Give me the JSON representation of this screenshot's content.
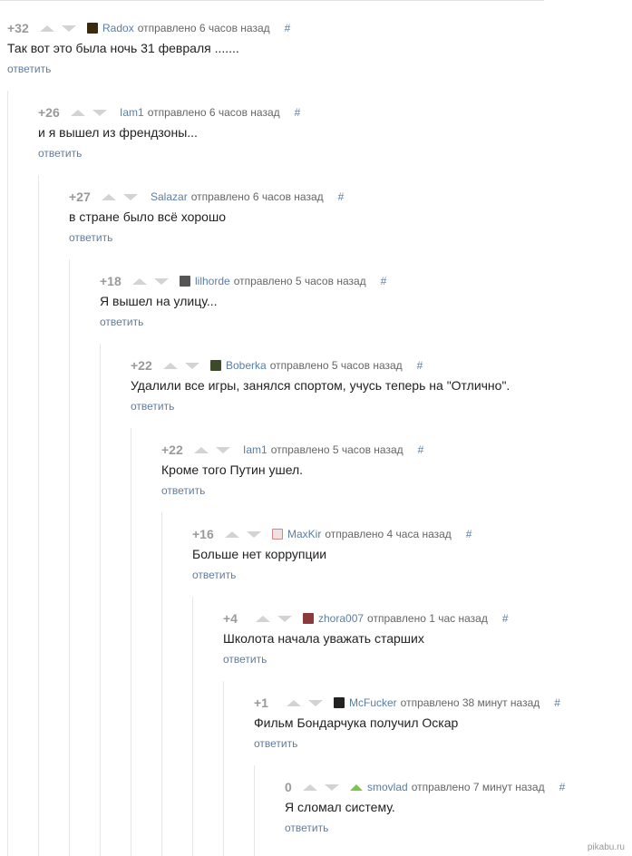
{
  "comments": [
    {
      "score": "+32",
      "author": "Radox",
      "sent": "отправлено 6 часов назад",
      "hash": "#",
      "text": "Так вот это была ночь 31 февраля .......",
      "reply": "ответить"
    },
    {
      "score": "+26",
      "author": "Iam1",
      "sent": "отправлено 6 часов назад",
      "hash": "#",
      "text": "и я вышел из френдзоны...",
      "reply": "ответить"
    },
    {
      "score": "+27",
      "author": "Salazar",
      "sent": "отправлено 6 часов назад",
      "hash": "#",
      "text": "в стране было всё хорошо",
      "reply": "ответить"
    },
    {
      "score": "+18",
      "author": "lilhorde",
      "sent": "отправлено 5 часов назад",
      "hash": "#",
      "text": "Я вышел на улицу...",
      "reply": "ответить"
    },
    {
      "score": "+22",
      "author": "Boberka",
      "sent": "отправлено 5 часов назад",
      "hash": "#",
      "text": "Удалили все игры, занялся спортом, учусь теперь на \"Отлично\".",
      "reply": "ответить"
    },
    {
      "score": "+22",
      "author": "Iam1",
      "sent": "отправлено 5 часов назад",
      "hash": "#",
      "text": "Кроме того Путин ушел.",
      "reply": "ответить"
    },
    {
      "score": "+16",
      "author": "MaxKir",
      "sent": "отправлено 4 часа назад",
      "hash": "#",
      "text": "Больше нет коррупции",
      "reply": "ответить"
    },
    {
      "score": "+4",
      "author": "zhora007",
      "sent": "отправлено 1 час назад",
      "hash": "#",
      "text": "Школота начала уважать старших",
      "reply": "ответить"
    },
    {
      "score": "+1",
      "author": "McFucker",
      "sent": "отправлено 38 минут назад",
      "hash": "#",
      "text": "Фильм Бондарчука получил Оскар",
      "reply": "ответить"
    },
    {
      "score": "0",
      "author": "smovlad",
      "sent": "отправлено 7 минут назад",
      "hash": "#",
      "text": "Я сломал систему.",
      "reply": "ответить"
    }
  ],
  "watermark": "pikabu.ru"
}
